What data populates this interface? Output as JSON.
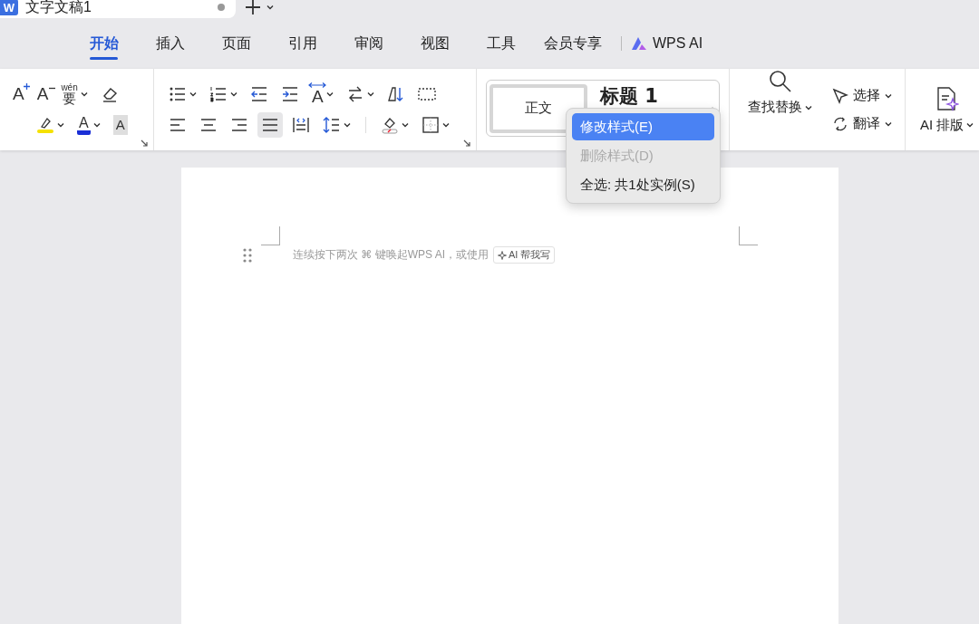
{
  "title_bar": {
    "logo": "W",
    "document_tab": {
      "title": "文字文稿1",
      "modified": true
    }
  },
  "ribbon_tabs": [
    {
      "label": "开始",
      "selected": true
    },
    {
      "label": "插入",
      "selected": false
    },
    {
      "label": "页面",
      "selected": false
    },
    {
      "label": "引用",
      "selected": false
    },
    {
      "label": "审阅",
      "selected": false
    },
    {
      "label": "视图",
      "selected": false
    },
    {
      "label": "工具",
      "selected": false
    },
    {
      "label": "会员专享",
      "selected": false
    },
    {
      "label": "WPS AI",
      "selected": false,
      "kind": "ai"
    }
  ],
  "toolbar": {
    "font_group": {
      "row_1": [
        {
          "kind": "font-grow",
          "glyph": "A",
          "caret": false
        },
        {
          "kind": "font-shrink",
          "glyph": "A",
          "caret": false
        },
        {
          "kind": "pinyin",
          "glyph": "wén",
          "glyph_2": "要",
          "caret": true
        },
        {
          "kind": "eraser",
          "caret": false
        }
      ],
      "row_2": [
        {
          "kind": "highlight",
          "caret": true
        },
        {
          "kind": "font-color",
          "glyph": "A",
          "caret": true
        },
        {
          "kind": "shading",
          "glyph": "A",
          "caret": false
        }
      ]
    },
    "paragraph_group": {
      "row_1": [
        {
          "kind": "bullets",
          "caret": true
        },
        {
          "kind": "numbering",
          "caret": true
        },
        {
          "kind": "outdent",
          "caret": false
        },
        {
          "kind": "indent",
          "caret": false
        },
        {
          "kind": "char-spacing",
          "glyph": "A",
          "caret": true
        },
        {
          "kind": "direction",
          "caret": true
        },
        {
          "kind": "sort",
          "caret": false
        },
        {
          "kind": "tabs",
          "caret": false
        }
      ],
      "row_2": [
        {
          "kind": "align-left",
          "caret": false,
          "selected": false
        },
        {
          "kind": "align-center",
          "caret": false,
          "selected": false
        },
        {
          "kind": "align-right",
          "caret": false,
          "selected": false
        },
        {
          "kind": "justify",
          "caret": false,
          "selected": true
        },
        {
          "kind": "distribute",
          "caret": false,
          "selected": false
        },
        {
          "kind": "line-spacing",
          "caret": true
        },
        {
          "kind": "separator"
        },
        {
          "kind": "fill",
          "caret": true
        },
        {
          "kind": "border",
          "caret": true
        }
      ]
    },
    "styles": [
      {
        "label": "正文",
        "selected": true
      },
      {
        "label": "标题 1",
        "selected": false
      }
    ],
    "find_replace": "查找替换",
    "select": "选择",
    "translate": "翻译",
    "ai_layout": "AI 排版"
  },
  "context_menu": [
    {
      "label": "修改样式(E)",
      "selected": true,
      "disabled": false
    },
    {
      "label": "删除样式(D)",
      "selected": false,
      "disabled": true
    },
    {
      "label": "全选: 共1处实例(S)",
      "selected": false,
      "disabled": false
    }
  ],
  "document": {
    "hint": "连续按下两次 ⌘ 键唤起WPS AI，或使用",
    "ai_button": "AI 帮我写"
  }
}
